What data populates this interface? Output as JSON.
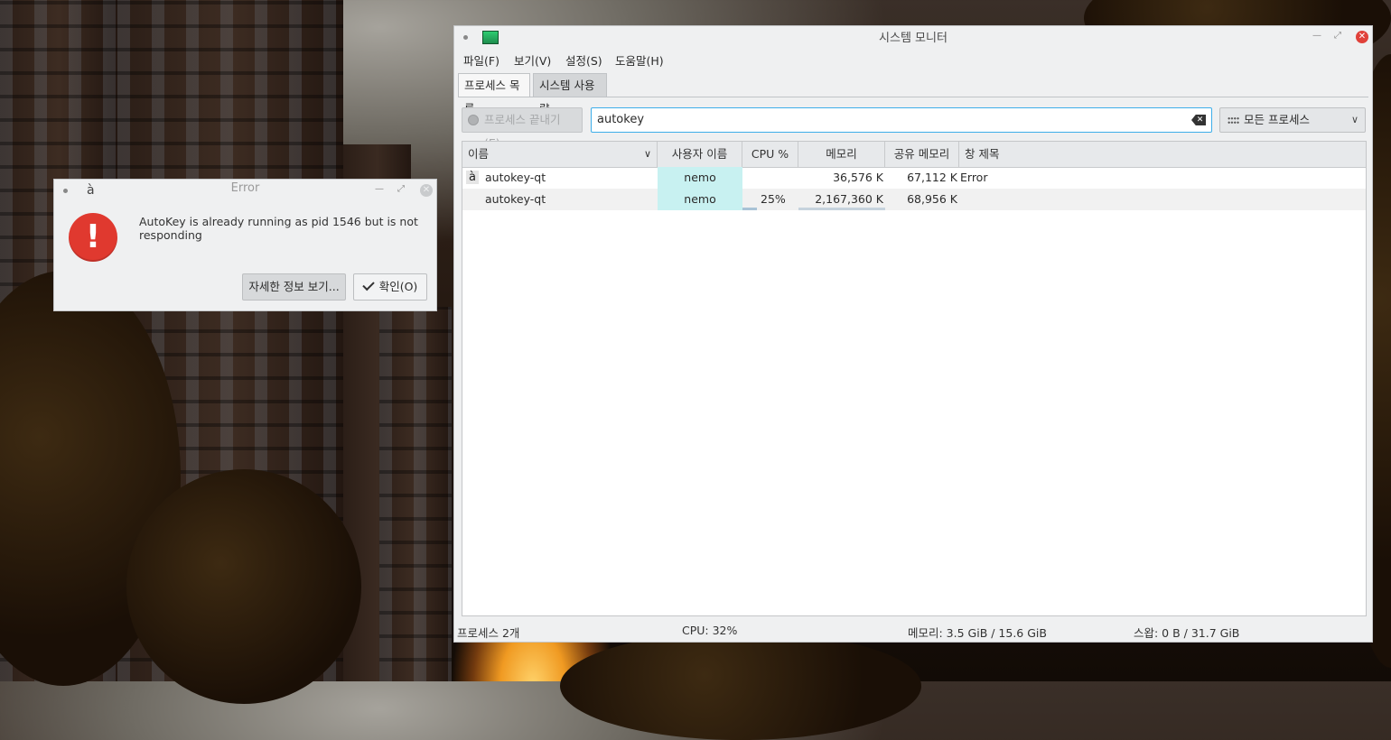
{
  "sysmon": {
    "title": "시스템 모니터",
    "menu": [
      "파일(F)",
      "보기(V)",
      "설정(S)",
      "도움말(H)"
    ],
    "tabs": [
      "프로세스 목록",
      "시스템 사용량"
    ],
    "end_process_label": "프로세스 끝내기(E)...",
    "search_value": "autokey",
    "filter_label": "모든 프로세스",
    "columns": [
      "이름",
      "사용자 이름",
      "CPU %",
      "메모리",
      "공유 메모리",
      "창 제목"
    ],
    "rows": [
      {
        "icon": "à",
        "name": "autokey-qt",
        "user": "nemo",
        "cpu": "",
        "mem": "36,576 K",
        "shared": "67,112 K",
        "window": "Error"
      },
      {
        "icon": "",
        "name": "autokey-qt",
        "user": "nemo",
        "cpu": "25%",
        "cpu_fraction": 0.25,
        "mem": "2,167,360 K",
        "shared": "68,956 K",
        "window": ""
      }
    ],
    "status": {
      "processes": "프로세스 2개",
      "cpu": "CPU: 32%",
      "memory": "메모리: 3.5 GiB / 15.6 GiB",
      "swap": "스왑: 0 B / 31.7 GiB"
    }
  },
  "dialog": {
    "title": "Error",
    "app_glyph": "à",
    "message": "AutoKey is already running as pid 1546 but is not responding",
    "details_label": "자세한 정보 보기...",
    "ok_label": "확인(O)"
  },
  "colors": {
    "accent": "#3daee9",
    "error": "#e0392f",
    "user_cell": "#c8f1f1"
  }
}
